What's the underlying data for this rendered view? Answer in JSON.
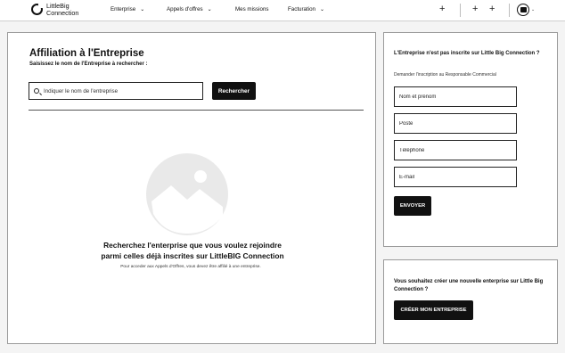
{
  "header": {
    "logo_line1": "LittleBig",
    "logo_line2": "Connection",
    "nav": [
      {
        "label": "Enterprise",
        "has_dropdown": true
      },
      {
        "label": "Appels d'offres",
        "has_dropdown": true
      },
      {
        "label": "Mes missions",
        "has_dropdown": false
      },
      {
        "label": "Facturation",
        "has_dropdown": true
      }
    ],
    "chevron": "⌄"
  },
  "main": {
    "title": "Affiliation à l'Entreprise",
    "subtitle": "Saisissez le nom de l'Entreprise à rechercher :",
    "search_placeholder": "Indiquer le nom de l'entreprise",
    "search_value": "",
    "search_button": "Rechercher",
    "empty_line1": "Recherchez l'enterprise que vous voulez rejoindre",
    "empty_line2": "parmi celles déjà inscrites sur LittleBIG Connection",
    "empty_note": "Pour acceder aux Appels d'Offres, vous devez être affilié à une entreprise."
  },
  "signup": {
    "title": "L'Entreprise n'est pas inscrite sur Little Big Connection ?",
    "subtitle": "Demander l'inscription au  Responsable Commercial",
    "fields": {
      "name": "Nom et prénom",
      "role": "Poste",
      "phone": "Téléphone",
      "email": "E-mail"
    },
    "send_button": "ENVOYER"
  },
  "create": {
    "title": "Vous souhaitez créer une nouvelle enterprise sur Little Big Connection ?",
    "button": "CRÉER MON ENTREPRISE"
  },
  "colors": {
    "primary": "#111111",
    "background": "#f4f4f4",
    "card_border": "#9a9a9a",
    "illustration": "#e9e9e9"
  }
}
